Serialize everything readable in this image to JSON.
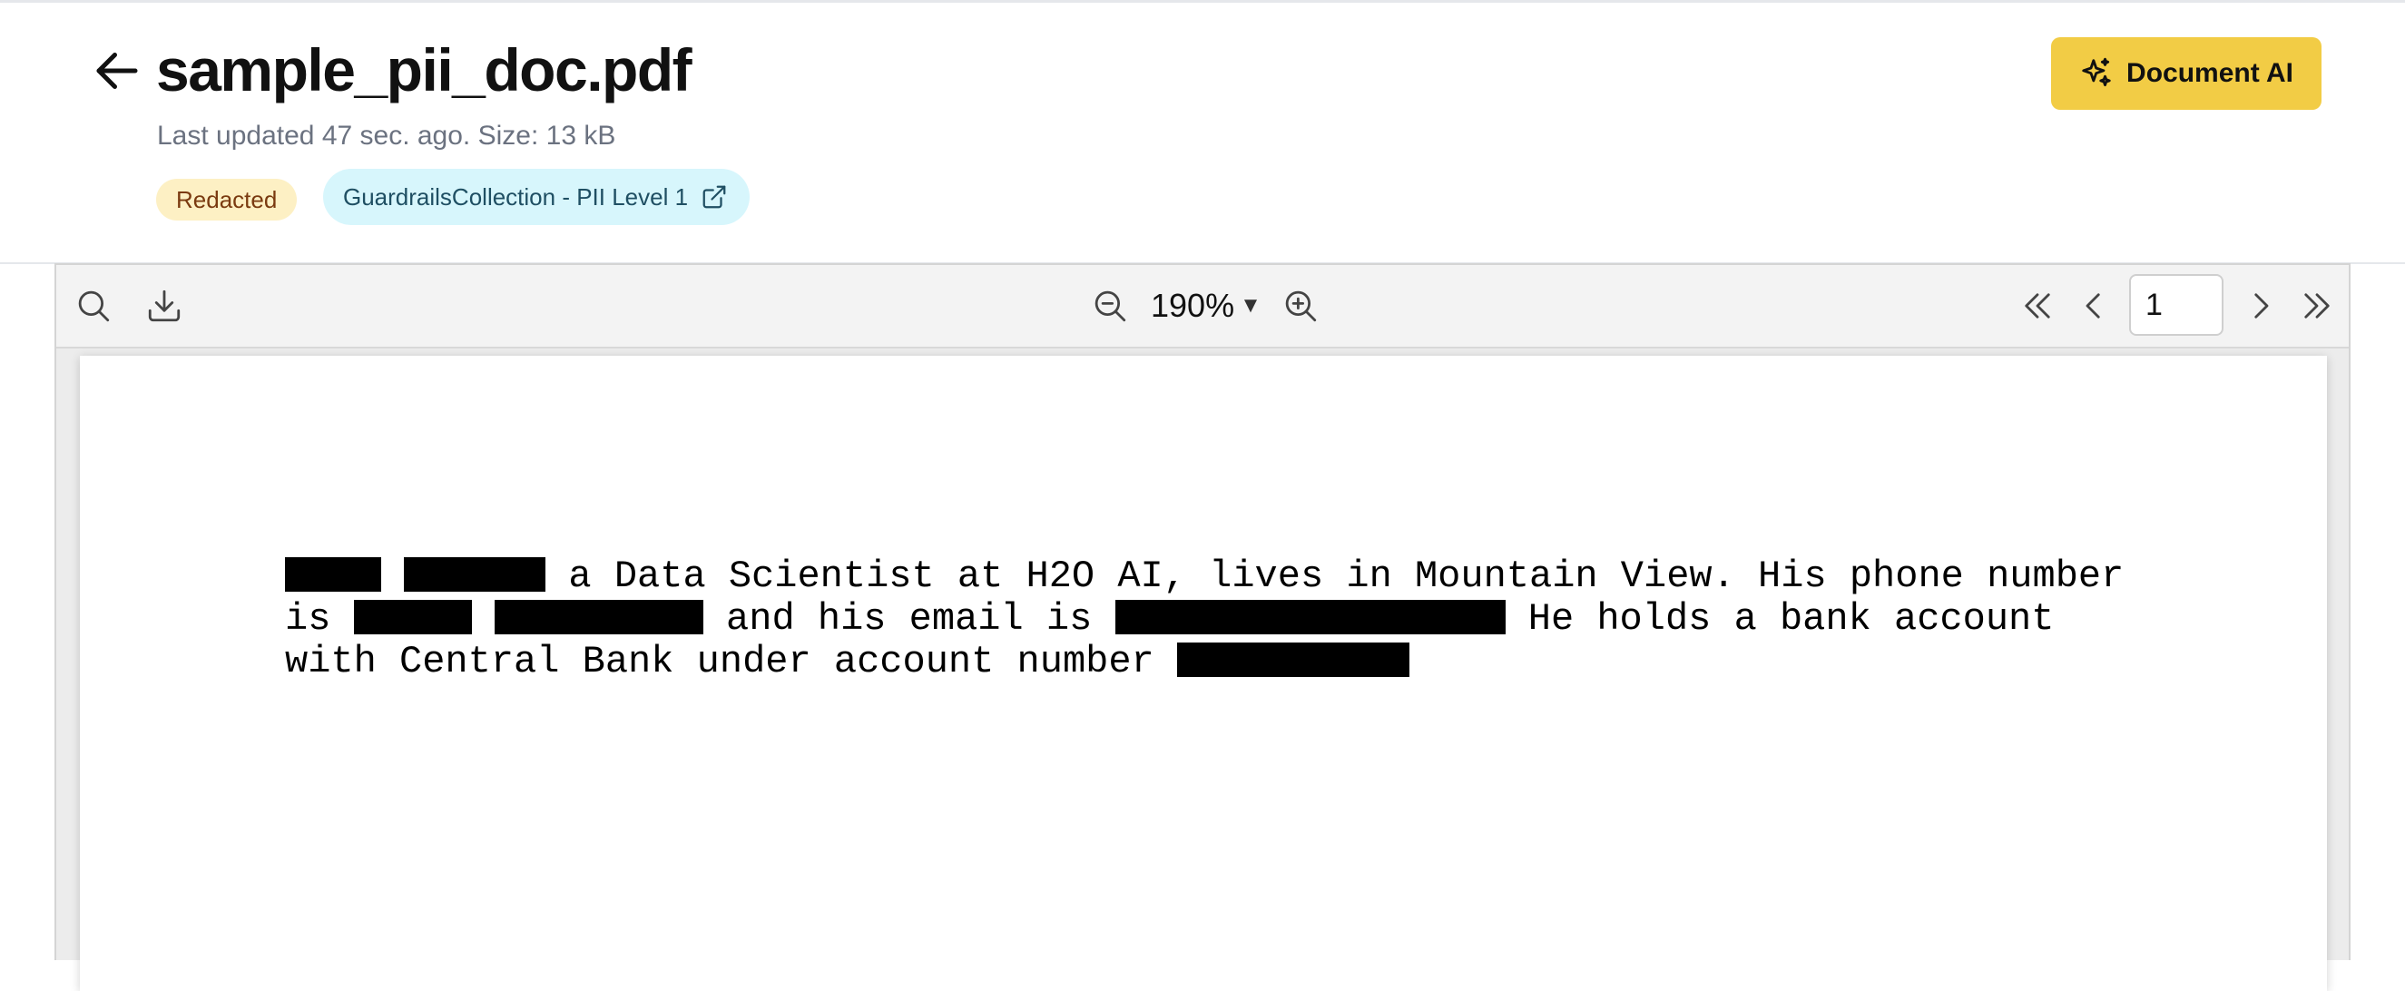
{
  "header": {
    "title": "sample_pii_doc.pdf",
    "meta": "Last updated 47 sec. ago. Size: 13 kB",
    "badges": {
      "status": "Redacted",
      "collection": "GuardrailsCollection - PII Level 1"
    },
    "document_ai_label": "Document AI"
  },
  "colors": {
    "accent_button": "#f2cc45",
    "redacted_badge_bg": "#fdf0c4",
    "collection_badge_bg": "#d7f6fc"
  },
  "toolbar": {
    "zoom": "190%",
    "page_value": "1",
    "icons": [
      "search-icon",
      "download-icon",
      "zoom-out-icon",
      "zoom-in-icon",
      "first-page-icon",
      "prev-page-icon",
      "next-page-icon",
      "last-page-icon"
    ]
  },
  "document": {
    "line1_text": " a Data Scientist at H2O AI, lives in Mountain View. His phone number",
    "line2_prefix": "is ",
    "line2_middle": " and his email is ",
    "line2_suffix": " He holds a bank account",
    "line3_text": "with Central Bank under account number "
  }
}
